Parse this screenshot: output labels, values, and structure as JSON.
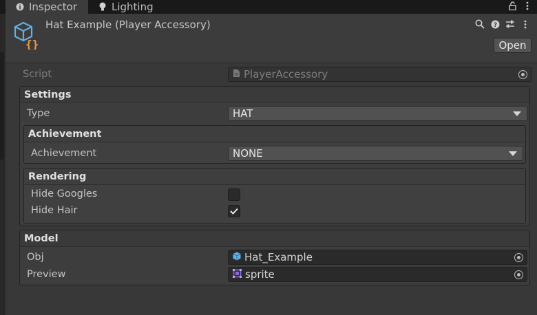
{
  "tabs": [
    {
      "label": "Inspector",
      "icon": "info-icon",
      "active": true
    },
    {
      "label": "Lighting",
      "icon": "lightbulb-icon",
      "active": false
    }
  ],
  "header": {
    "title": "Hat Example (Player Accessory)",
    "open_label": "Open",
    "icons": [
      "search-icon",
      "help-icon",
      "preset-icon",
      "kebab-menu-icon"
    ]
  },
  "script_row": {
    "label": "Script",
    "value": "PlayerAccessory"
  },
  "settings": {
    "title": "Settings",
    "type_label": "Type",
    "type_value": "HAT",
    "achievement": {
      "title": "Achievement",
      "label": "Achievement",
      "value": "NONE"
    },
    "rendering": {
      "title": "Rendering",
      "hide_googles_label": "Hide Googles",
      "hide_googles_checked": false,
      "hide_hair_label": "Hide Hair",
      "hide_hair_checked": true
    }
  },
  "model": {
    "title": "Model",
    "obj_label": "Obj",
    "obj_value": "Hat_Example",
    "preview_label": "Preview",
    "preview_value": "sprite"
  },
  "colors": {
    "accent_blue": "#5fb0e8",
    "accent_orange": "#f39a3a",
    "sprite_purple": "#8a6bd6"
  }
}
